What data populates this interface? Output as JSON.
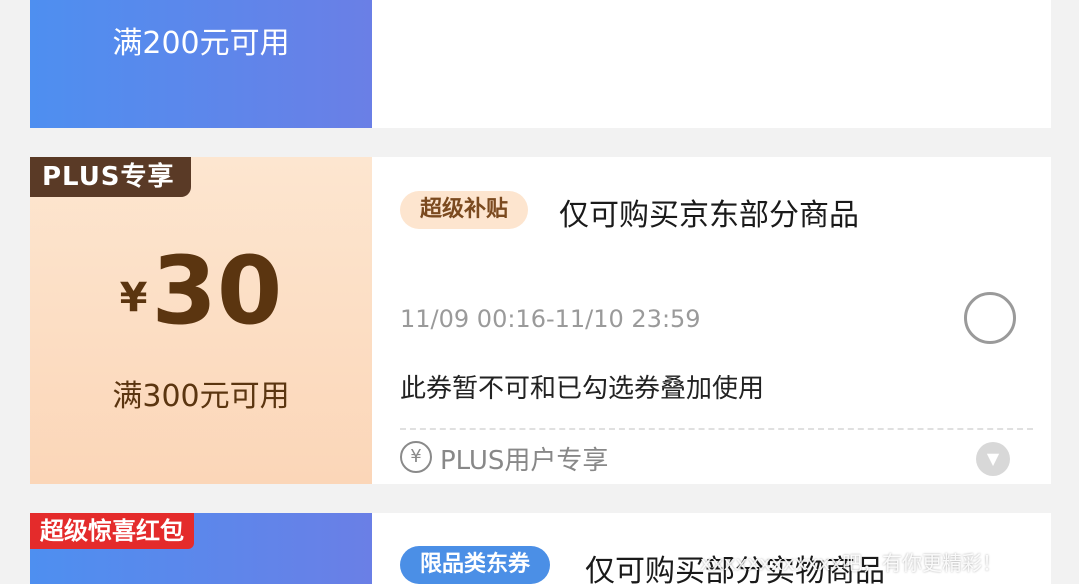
{
  "top_card": {
    "condition": "满200元可用",
    "accent": "#5a86ea"
  },
  "mid_card": {
    "tag": "PLUS专享",
    "currency": "¥",
    "amount": "30",
    "condition": "满300元可用",
    "badge": "超级补贴",
    "title": "仅可购买京东部分商品",
    "validity": "11/09 00:16-11/10 23:59",
    "note": "此券暂不可和已勾选券叠加使用",
    "footer_icon": "¥",
    "footer": "PLUS用户专享",
    "selected": false
  },
  "bottom_card": {
    "tag": "超级惊喜红包",
    "badge": "限品类东券",
    "title": "仅可购买部分实物商品"
  },
  "watermark": "xxxxxxxxxxxx吧，有你更精彩！"
}
